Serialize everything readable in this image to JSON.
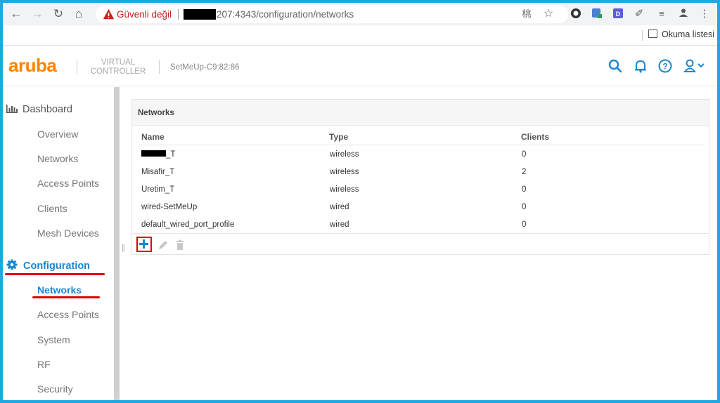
{
  "browser": {
    "security_text": "Güvenli değil",
    "url_visible": "207:4343/configuration/networks",
    "reading_list_label": "Okuma listesi"
  },
  "app": {
    "logo": "aruba",
    "vc_label": "VIRTUAL CONTROLLER",
    "vc_name": "SetMeUp-C9:82:86"
  },
  "sidebar": {
    "dashboard": {
      "label": "Dashboard",
      "items": [
        "Overview",
        "Networks",
        "Access Points",
        "Clients",
        "Mesh Devices"
      ]
    },
    "configuration": {
      "label": "Configuration",
      "items": [
        "Networks",
        "Access Points",
        "System",
        "RF",
        "Security"
      ],
      "active_item": "Networks"
    }
  },
  "networks_panel": {
    "title": "Networks",
    "columns": [
      "Name",
      "Type",
      "Clients"
    ],
    "rows": [
      {
        "name": "_T",
        "type": "wireless",
        "clients": "0",
        "redacted_prefix": true
      },
      {
        "name": "Misafir_T",
        "type": "wireless",
        "clients": "2"
      },
      {
        "name": "Uretim_T",
        "type": "wireless",
        "clients": "0"
      },
      {
        "name": "wired-SetMeUp",
        "type": "wired",
        "clients": "0"
      },
      {
        "name": "default_wired_port_profile",
        "type": "wired",
        "clients": "0"
      }
    ]
  },
  "colors": {
    "accent": "#1a86d0",
    "brand": "#ff8300",
    "annotation": "#e00000",
    "frame": "#1ea7e1"
  },
  "icons": [
    "back-icon",
    "forward-icon",
    "reload-icon",
    "home-icon",
    "warning-icon",
    "translate-icon",
    "star-icon",
    "extension-icon",
    "profile-icon",
    "menu-icon",
    "search-icon",
    "bell-icon",
    "help-icon",
    "user-icon",
    "dashboard-icon",
    "gear-icon",
    "add-icon",
    "edit-icon",
    "delete-icon"
  ]
}
